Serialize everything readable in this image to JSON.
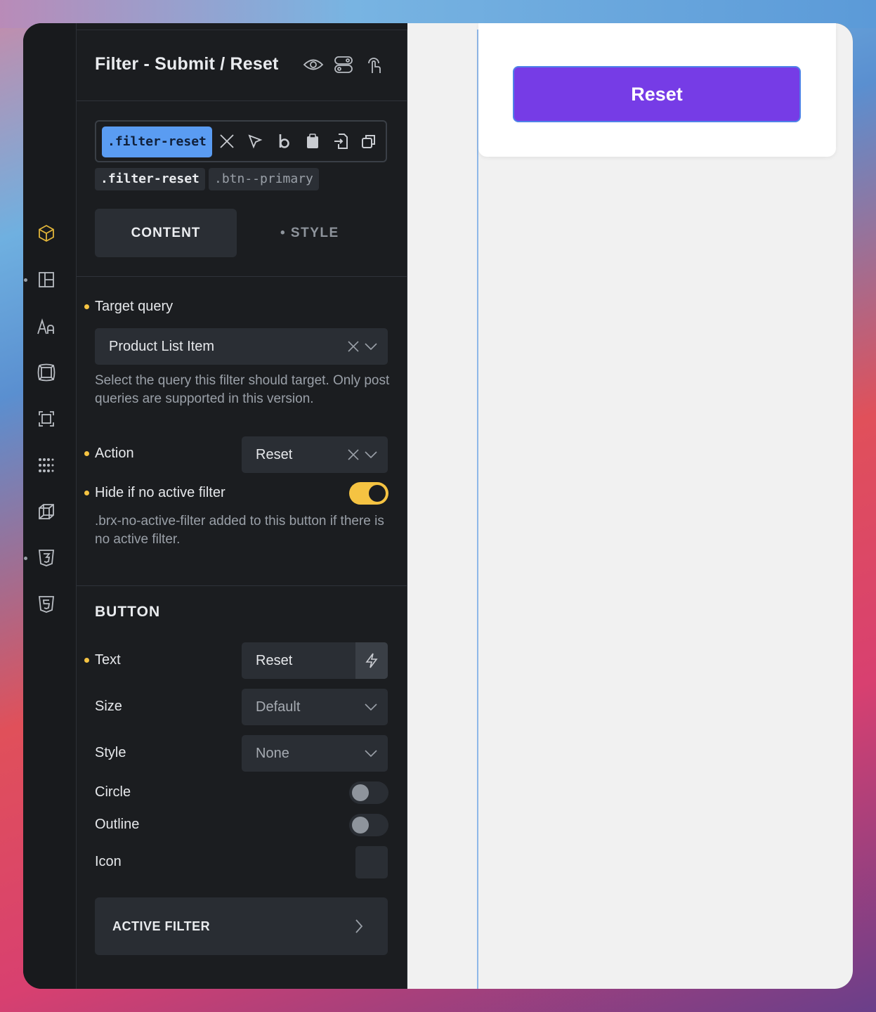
{
  "panel": {
    "title": "Filter - Submit / Reset",
    "selected_class": ".filter-reset",
    "classes": [
      ".filter-reset",
      ".btn--primary"
    ],
    "tabs": {
      "content": "CONTENT",
      "style": "• STYLE",
      "active": "CONTENT"
    }
  },
  "target_query": {
    "label": "Target query",
    "value": "Product List Item",
    "help": "Select the query this filter should target. Only post queries are supported in this version."
  },
  "action": {
    "label": "Action",
    "value": "Reset"
  },
  "hide_if_no_active": {
    "label": "Hide if no active filter",
    "enabled": true,
    "help": ".brx-no-active-filter added to this button if there is no active filter."
  },
  "button_section": {
    "title": "BUTTON",
    "text": {
      "label": "Text",
      "value": "Reset"
    },
    "size": {
      "label": "Size",
      "value": "Default"
    },
    "style": {
      "label": "Style",
      "value": "None"
    },
    "circle": {
      "label": "Circle",
      "enabled": false
    },
    "outline": {
      "label": "Outline",
      "enabled": false
    },
    "icon": {
      "label": "Icon"
    }
  },
  "accordion": {
    "active_filter": "ACTIVE FILTER"
  },
  "canvas": {
    "button_label": "Reset"
  },
  "colors": {
    "accent_yellow": "#f5c342",
    "chip_blue": "#5a9cf2",
    "button_purple": "#763ce6"
  },
  "rail_icons": [
    "cube-icon",
    "layout-icon",
    "typography-icon",
    "box-model-icon",
    "frame-icon",
    "grid-dots-icon",
    "3d-box-icon",
    "css3-icon",
    "html5-icon"
  ]
}
